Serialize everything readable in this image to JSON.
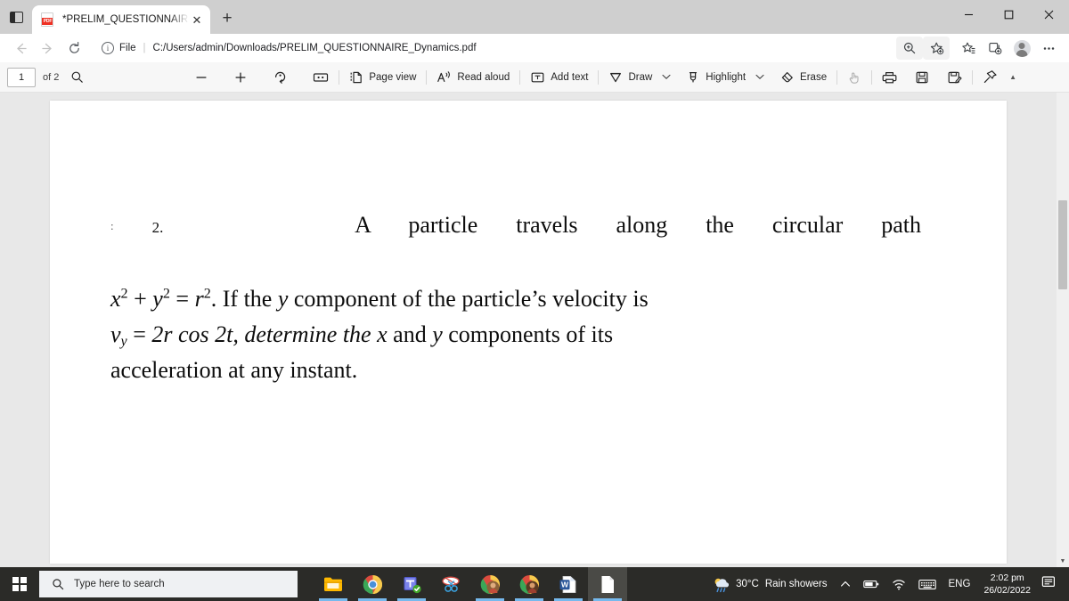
{
  "browser": {
    "tab": {
      "title": "*PRELIM_QUESTIONNAIRE_Dynamics.pdf",
      "favicon": "pdf-file-icon",
      "close_label": "✕"
    },
    "new_tab_label": "+",
    "tab_search_name": "tab-actions-menu",
    "window_controls": {
      "minimize": "minimize-icon",
      "maximize": "maximize-icon",
      "close": "close-icon"
    },
    "nav": {
      "back": "back-arrow-icon",
      "forward": "forward-arrow-icon",
      "refresh": "refresh-icon"
    },
    "omnibox": {
      "info_glyph": "i",
      "scheme_label": "File",
      "separator": "|",
      "url": "C:/Users/admin/Downloads/PRELIM_QUESTIONNAIRE_Dynamics.pdf"
    },
    "address_icons": [
      {
        "name": "zoom-search-icon",
        "glyph": "zoom"
      },
      {
        "name": "add-favorite-icon",
        "glyph": "star-plus"
      },
      {
        "name": "favorites-icon",
        "glyph": "star-list"
      },
      {
        "name": "collections-icon",
        "glyph": "collections"
      },
      {
        "name": "profile-avatar",
        "glyph": "avatar"
      },
      {
        "name": "settings-and-more-icon",
        "glyph": "⋯"
      }
    ]
  },
  "pdf_toolbar": {
    "page_number": "1",
    "page_count_label": "of 2",
    "search_icon": "search-icon",
    "zoom_out": "minus-icon",
    "zoom_in": "plus-icon",
    "rotate": "rotate-icon",
    "fit_page": "fit-to-page-icon",
    "page_view_label": "Page view",
    "read_aloud_label": "Read aloud",
    "add_text_label": "Add text",
    "draw_label": "Draw",
    "highlight_label": "Highlight",
    "erase_label": "Erase",
    "chevron": "∨",
    "right_tools": [
      {
        "name": "select-tool-icon",
        "glyph": "hand"
      },
      {
        "name": "print-icon",
        "glyph": "printer"
      },
      {
        "name": "save-icon",
        "glyph": "floppy"
      },
      {
        "name": "save-as-icon",
        "glyph": "floppy-pen"
      },
      {
        "name": "pin-icon",
        "glyph": "pin"
      }
    ],
    "scroll_up_glyph": "▲"
  },
  "document": {
    "question_number": "2.",
    "leading_marks": ":",
    "text_line1_a": "A  particle  travels  along  the  circular  path",
    "equation_x": "x",
    "equation_sup": "2",
    "equation_plus": "+",
    "equation_y": "y",
    "equation_eq": "=",
    "equation_r": "r",
    "line2_rest": ". If the",
    "italic_y": "y",
    "line2_tail": "component of the particle’s velocity is",
    "v_symbol": "v",
    "v_sub": "y",
    "line3_eq": "=",
    "line3_expr": "2r  cos 2t, determine  the",
    "italic_x3": "x",
    "line3_and": "and",
    "italic_y3": "y",
    "line3_tail": "components  of  its",
    "line4": "acceleration at any instant."
  },
  "scrollbar": {
    "thumb_name": "vertical-scrollbar-thumb",
    "down_glyph": "▼"
  },
  "taskbar": {
    "start_name": "start-button",
    "search_placeholder": "Type here to search",
    "search_icon": "search-icon",
    "apps": [
      {
        "name": "taskbar-file-explorer",
        "glyph": "file-explorer",
        "active": false,
        "running": true
      },
      {
        "name": "taskbar-chrome",
        "glyph": "chrome",
        "active": false,
        "running": true
      },
      {
        "name": "taskbar-teams",
        "glyph": "teams",
        "active": false,
        "running": true
      },
      {
        "name": "taskbar-snipping-tool",
        "glyph": "snip",
        "active": false,
        "running": false
      },
      {
        "name": "taskbar-chrome-profile-1",
        "glyph": "chrome-profile",
        "active": false,
        "running": true
      },
      {
        "name": "taskbar-chrome-profile-2",
        "glyph": "chrome-profile",
        "active": false,
        "running": true
      },
      {
        "name": "taskbar-word",
        "glyph": "word",
        "active": false,
        "running": true
      },
      {
        "name": "taskbar-edge-pdf",
        "glyph": "document",
        "active": true,
        "running": true
      }
    ],
    "weather_temp": "30°C",
    "weather_desc": "Rain showers",
    "tray": {
      "show_hidden": "∧",
      "battery": "battery-icon",
      "network": "wifi-icon",
      "keyboard": "keyboard-icon",
      "language": "ENG"
    },
    "clock_time": "2:02 pm",
    "clock_date": "26/02/2022",
    "notifications": "notifications-icon"
  },
  "colors": {
    "titlebar": "#cfcfcf",
    "toolbar": "#f7f7f7",
    "viewer_bg": "#e8e8e8",
    "taskbar": "#2b2b28",
    "pdf_red": "#ee3124",
    "accent_blue": "#76b9ed"
  }
}
